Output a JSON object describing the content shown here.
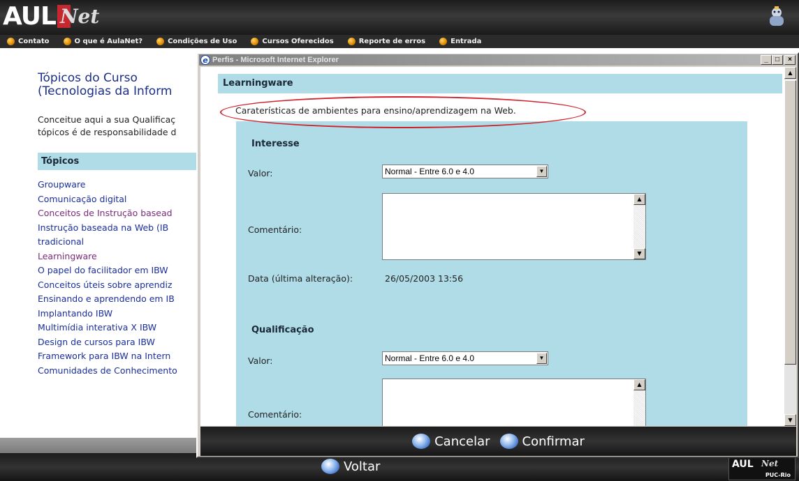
{
  "header": {
    "logo_main": "AUL",
    "logo_sub": "Net",
    "menu": [
      "Contato",
      "O que é AulaNet?",
      "Condições de Uso",
      "Cursos Oferecidos",
      "Reporte de erros",
      "Entrada"
    ]
  },
  "page": {
    "course_title": "Tópicos do Curso\n(Tecnologias da Inform",
    "intro": "Conceitue aqui a sua Qualificaç\ntópicos é de responsabilidade d",
    "topics_heading": "Tópicos",
    "topics": [
      {
        "label": "Groupware",
        "visited": false
      },
      {
        "label": "Comunicação digital",
        "visited": false
      },
      {
        "label": "Conceitos de Instrução basead",
        "visited": true
      },
      {
        "label": "Instrução baseada na Web (IB\ntradicional",
        "visited": false
      },
      {
        "label": "Learningware",
        "visited": true
      },
      {
        "label": "O papel do facilitador em IBW",
        "visited": false
      },
      {
        "label": "Conceitos úteis sobre aprendiz",
        "visited": false
      },
      {
        "label": "Ensinando e aprendendo em IB",
        "visited": false
      },
      {
        "label": "Implantando IBW",
        "visited": false
      },
      {
        "label": "Multimídia interativa X IBW",
        "visited": false
      },
      {
        "label": "Design de cursos para IBW",
        "visited": false
      },
      {
        "label": "Framework para IBW na Intern",
        "visited": false
      },
      {
        "label": "Comunidades de Conhecimento",
        "visited": false
      }
    ]
  },
  "footer": {
    "back_label": "Voltar",
    "logo_main": "AUL",
    "logo_sub": "Net",
    "logo_org": "PUC-Rio"
  },
  "popup": {
    "window_title": "Perfis - Microsoft Internet Explorer",
    "window_controls": [
      "_",
      "□",
      "×"
    ],
    "section_header": "Learningware",
    "description": "Caraterísticas de ambientes para ensino/aprendizagem na Web.",
    "interesse": {
      "title": "Interesse",
      "valor_label": "Valor:",
      "valor_selected": "Normal - Entre 6.0 e 4.0",
      "comentario_label": "Comentário:",
      "comentario_value": "",
      "data_label": "Data (última alteração):",
      "data_value": "26/05/2003 13:56"
    },
    "qualificacao": {
      "title": "Qualificação",
      "valor_label": "Valor:",
      "valor_selected": "Normal - Entre 6.0 e 4.0",
      "comentario_label": "Comentário:",
      "comentario_value": ""
    },
    "cancel_label": "Cancelar",
    "confirm_label": "Confirmar"
  },
  "colors": {
    "header_bg": "#2b2b2b",
    "panel_blue": "#b0dce7",
    "link": "#1a2e9c",
    "link_visited": "#7a2a7a",
    "annotation_red": "#d0202a"
  }
}
